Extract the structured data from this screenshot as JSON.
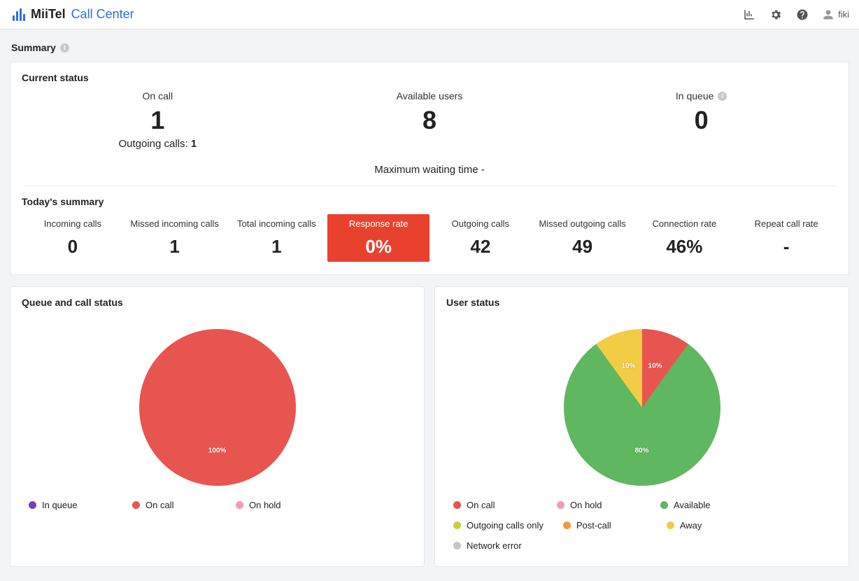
{
  "header": {
    "brand_main": "MiiTel",
    "brand_sub": "Call Center",
    "username": "fiki"
  },
  "page_title": "Summary",
  "current_status": {
    "section_label": "Current status",
    "on_call": {
      "label": "On call",
      "value": "1",
      "sub_label": "Outgoing calls:",
      "sub_value": "1"
    },
    "available": {
      "label": "Available users",
      "value": "8"
    },
    "in_queue": {
      "label": "In queue",
      "value": "0"
    },
    "wait_label": "Maximum waiting time",
    "wait_value": "-"
  },
  "today": {
    "section_label": "Today's summary",
    "cols": [
      {
        "label": "Incoming calls",
        "value": "0",
        "alert": false
      },
      {
        "label": "Missed incoming calls",
        "value": "1",
        "alert": false
      },
      {
        "label": "Total incoming calls",
        "value": "1",
        "alert": false
      },
      {
        "label": "Response rate",
        "value": "0%",
        "alert": true
      },
      {
        "label": "Outgoing calls",
        "value": "42",
        "alert": false
      },
      {
        "label": "Missed outgoing calls",
        "value": "49",
        "alert": false
      },
      {
        "label": "Connection rate",
        "value": "46%",
        "alert": false
      },
      {
        "label": "Repeat call rate",
        "value": "-",
        "alert": false
      }
    ]
  },
  "queue_card": {
    "title": "Queue and call status",
    "legend": [
      {
        "name": "In queue",
        "color": "#7a3fb8"
      },
      {
        "name": "On call",
        "color": "#e8554f"
      },
      {
        "name": "On hold",
        "color": "#f29bb7"
      }
    ]
  },
  "user_card": {
    "title": "User status",
    "legend": [
      {
        "name": "On call",
        "color": "#e8554f"
      },
      {
        "name": "On hold",
        "color": "#f29bb7"
      },
      {
        "name": "Available",
        "color": "#5fb760"
      },
      {
        "name": "Outgoing calls only",
        "color": "#c8cf3f"
      },
      {
        "name": "Post-call",
        "color": "#ef9a3c"
      },
      {
        "name": "Away",
        "color": "#f3cc46"
      },
      {
        "name": "Network error",
        "color": "#c3c6c9"
      }
    ]
  },
  "chart_data": [
    {
      "type": "pie",
      "title": "Queue and call status",
      "series": [
        {
          "name": "In queue",
          "value": 0,
          "color": "#7a3fb8"
        },
        {
          "name": "On call",
          "value": 100,
          "color": "#e8554f",
          "label": "100%"
        },
        {
          "name": "On hold",
          "value": 0,
          "color": "#f29bb7"
        }
      ]
    },
    {
      "type": "pie",
      "title": "User status",
      "series": [
        {
          "name": "On call",
          "value": 10,
          "color": "#e8554f",
          "label": "10%"
        },
        {
          "name": "Available",
          "value": 80,
          "color": "#5fb760",
          "label": "80%"
        },
        {
          "name": "Away",
          "value": 10,
          "color": "#f3cc46",
          "label": "10%"
        },
        {
          "name": "On hold",
          "value": 0,
          "color": "#f29bb7"
        },
        {
          "name": "Outgoing calls only",
          "value": 0,
          "color": "#c8cf3f"
        },
        {
          "name": "Post-call",
          "value": 0,
          "color": "#ef9a3c"
        },
        {
          "name": "Network error",
          "value": 0,
          "color": "#c3c6c9"
        }
      ]
    }
  ]
}
